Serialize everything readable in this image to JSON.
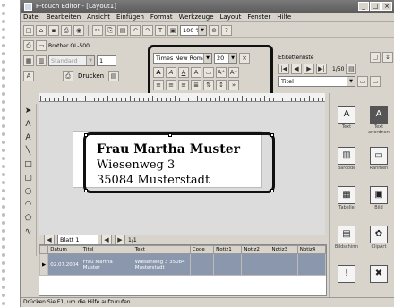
{
  "window": {
    "title": "P-touch Editor - [Layout1]"
  },
  "menu": [
    "Datei",
    "Bearbeiten",
    "Ansicht",
    "Einfügen",
    "Format",
    "Werkzeuge",
    "Layout",
    "Fenster",
    "Hilfe"
  ],
  "toolbar": {
    "zoom": "100 %",
    "printer": "Brother QL-500",
    "style": "Standard",
    "size_value": "1",
    "print_label": "Drucken"
  },
  "format": {
    "font": "Times New Roman",
    "size": "20"
  },
  "label_toolbar": {
    "title": "Etikettenliste",
    "page_count": "1/50",
    "field": "Titel"
  },
  "label": {
    "line1": "Frau Martha Muster",
    "line2": "Wiesenweg 3",
    "line3": "35084 Musterstadt"
  },
  "pagenav": {
    "sheet": "Blatt 1",
    "pages": "1/1"
  },
  "grid": {
    "headers": [
      "Datum",
      "Titel",
      "Text",
      "Code",
      "Notiz1",
      "Notiz2",
      "Notiz3",
      "Notiz4"
    ],
    "rows": [
      [
        "02.07.2004",
        "Frau Martha Muster",
        "Wiesenweg 3 35084 Musterstadt",
        "",
        "",
        "",
        "",
        ""
      ]
    ]
  },
  "objects": [
    "Text",
    "Text anordnen",
    "Barcode",
    "Rahmen",
    "Tabelle",
    "Bild",
    "Bildschirm",
    "ClipArt"
  ],
  "status": "Drücken Sie F1, um die Hilfe aufzurufen"
}
